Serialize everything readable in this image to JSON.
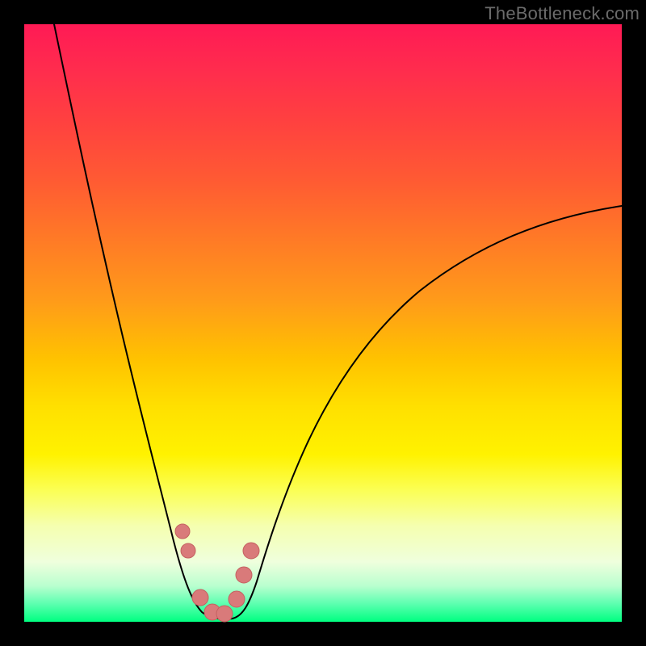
{
  "watermark": "TheBottleneck.com",
  "colors": {
    "frame": "#000000",
    "curve": "#000000",
    "marker": "#d97a7a",
    "gradient_top": "#ff1a55",
    "gradient_mid": "#fff200",
    "gradient_bottom": "#00ff80"
  },
  "chart_data": {
    "type": "line",
    "title": "",
    "xlabel": "",
    "ylabel": "",
    "xlim": [
      0,
      100
    ],
    "ylim": [
      0,
      100
    ],
    "grid": false,
    "legend": false,
    "notes": "V-shaped bottleneck curve. y ≈ percentage bottleneck (0 = ideal, 100 = severe). Minimum near x≈32. Axes unlabeled in source image; values estimated from pixel positions.",
    "series": [
      {
        "name": "bottleneck-curve",
        "x": [
          5,
          10,
          15,
          20,
          24,
          27,
          29,
          31,
          33,
          35,
          37,
          40,
          45,
          50,
          55,
          60,
          65,
          70,
          75,
          80,
          85,
          90,
          95,
          100
        ],
        "values": [
          100,
          84,
          66,
          46,
          28,
          14,
          6,
          2,
          1,
          2,
          4,
          9,
          18,
          26,
          33,
          39,
          44,
          48,
          52,
          55,
          58,
          60,
          62,
          64
        ]
      }
    ],
    "markers": {
      "name": "highlight-dots",
      "color": "#d97a7a",
      "x": [
        26.5,
        27.5,
        29.5,
        31.5,
        33.5,
        35.5,
        36.8,
        38.0
      ],
      "values": [
        15,
        12,
        4,
        1.5,
        1.5,
        4,
        8,
        12
      ]
    }
  }
}
